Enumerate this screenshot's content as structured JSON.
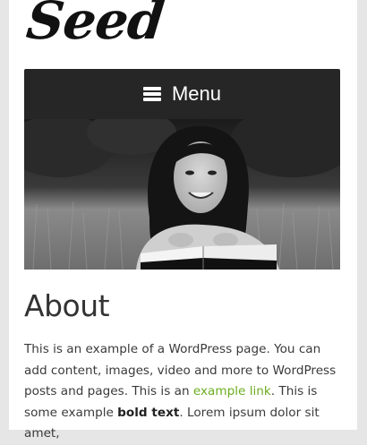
{
  "site": {
    "logo_text": "Seed"
  },
  "nav": {
    "menu_label": "Menu",
    "menu_icon": "hamburger-icon"
  },
  "page": {
    "title": "About",
    "paragraph": {
      "part1": "This is an example of a WordPress page. You can add content, images, video and more to WordPress posts and pages. This is an ",
      "link_text": "example link",
      "part2": ". This is some example ",
      "bold_text": "bold text",
      "part3": ". Lorem ipsum dolor sit amet,"
    }
  },
  "colors": {
    "menu_bg": "#262626",
    "link": "#6cac1e",
    "page_bg": "#ffffff",
    "outer_bg": "#e6e6e6"
  }
}
